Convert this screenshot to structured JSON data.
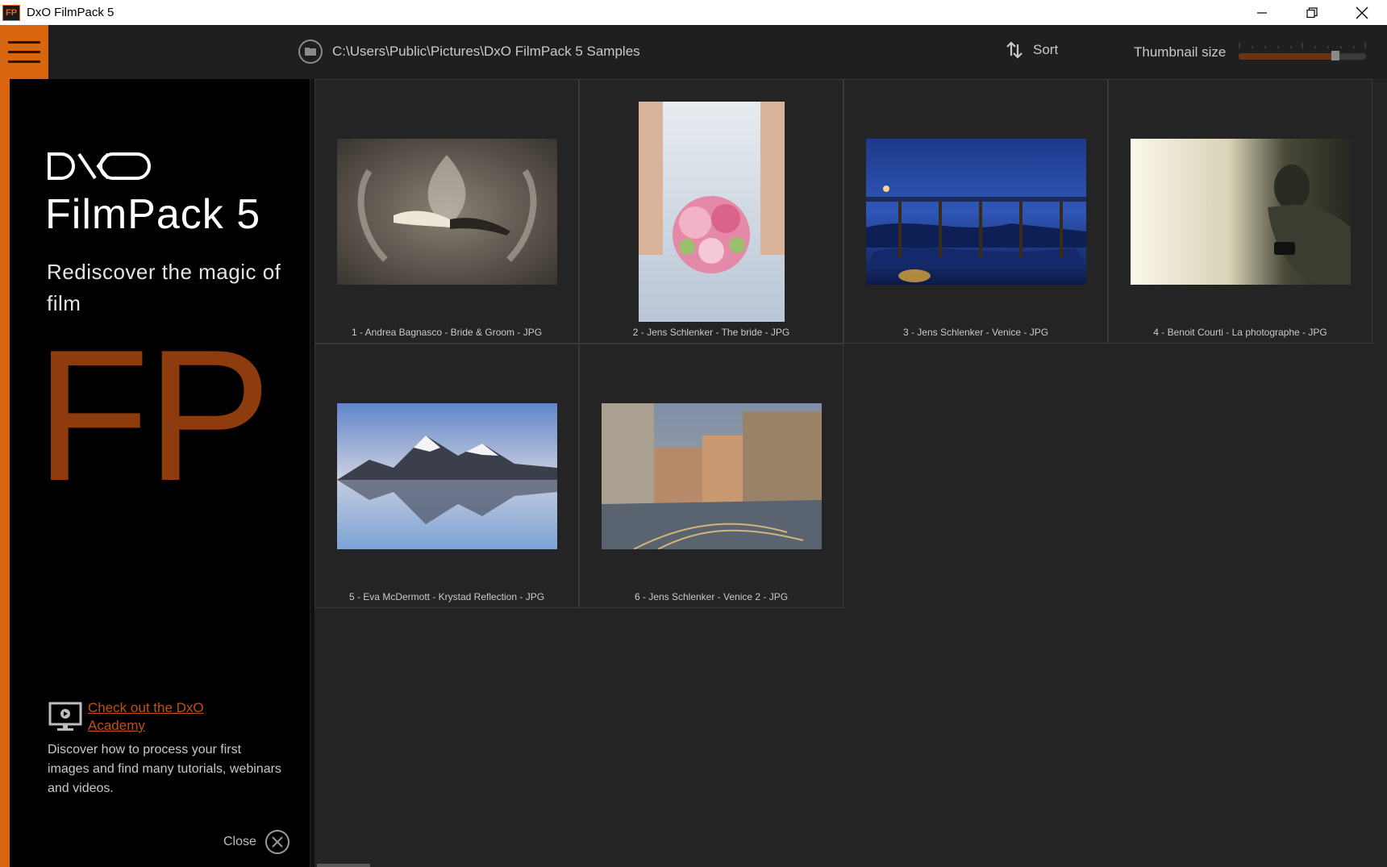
{
  "window": {
    "title": "DxO FilmPack 5",
    "app_icon_text": "FP"
  },
  "toolbar": {
    "path": "C:\\Users\\Public\\Pictures\\DxO FilmPack 5 Samples",
    "sort_label": "Sort",
    "thumbnail_size_label": "Thumbnail size",
    "thumbnail_size_level": 0.76
  },
  "sidebar": {
    "brand": "DXO",
    "product": "FilmPack 5",
    "tagline": "Rediscover the magic of film",
    "monogram": "FP",
    "academy_link": "Check out the DxO Academy",
    "academy_desc": "Discover how to process your first images and find many tutorials, webinars and videos.",
    "close_label": "Close"
  },
  "images": [
    {
      "caption": "1 - Andrea Bagnasco - Bride & Groom - JPG",
      "orientation": "landscape"
    },
    {
      "caption": "2 - Jens Schlenker - The bride - JPG",
      "orientation": "portrait"
    },
    {
      "caption": "3 - Jens Schlenker - Venice - JPG",
      "orientation": "landscape"
    },
    {
      "caption": "4 - Benoit Courti - La photographe - JPG",
      "orientation": "landscape"
    },
    {
      "caption": "5 - Eva McDermott - Krystad Reflection - JPG",
      "orientation": "landscape"
    },
    {
      "caption": "6 - Jens Schlenker - Venice 2 - JPG",
      "orientation": "landscape"
    }
  ],
  "colors": {
    "accent": "#d9660f",
    "monogram": "#8e3b0d",
    "link": "#c0501a"
  }
}
